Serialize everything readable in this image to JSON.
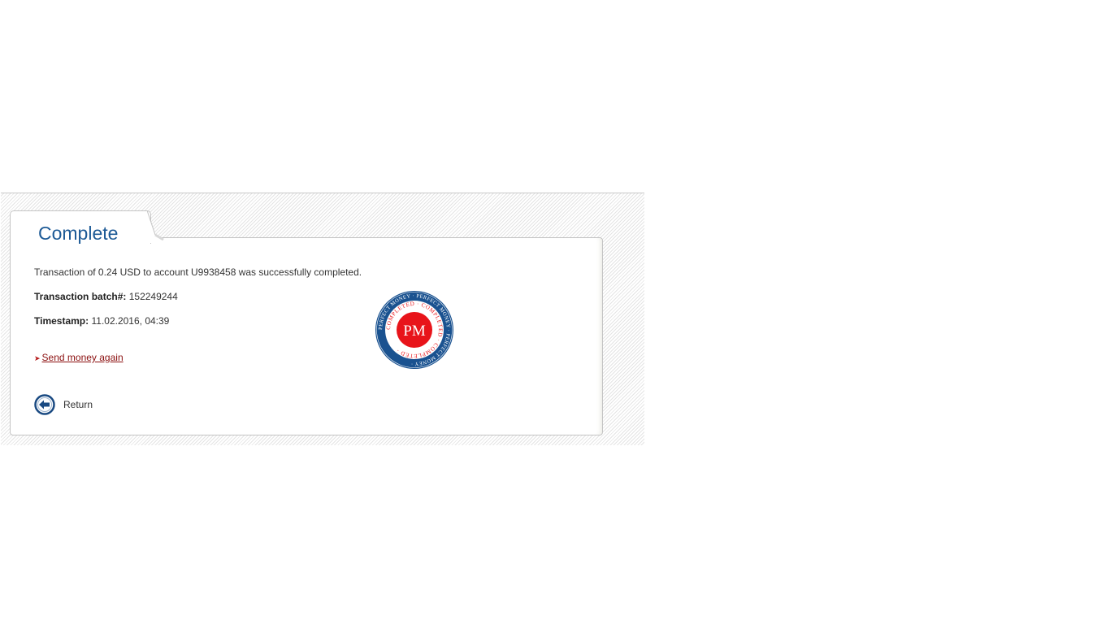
{
  "panel": {
    "title": "Complete"
  },
  "transaction": {
    "message": "Transaction of 0.24 USD to account U9938458 was successfully completed.",
    "batch_label": "Transaction batch#:",
    "batch_value": "152249244",
    "timestamp_label": "Timestamp:",
    "timestamp_value": "11.02.2016, 04:39"
  },
  "actions": {
    "send_again_label": "Send money again",
    "return_label": "Return"
  },
  "stamp": {
    "initials": "PM",
    "ring_text": "PERFECT MONEY",
    "inner_text": "COMPLETED"
  },
  "colors": {
    "title_blue": "#1d5a96",
    "link_red": "#8b0f0f",
    "stamp_red": "#e8141a",
    "stamp_blue": "#1a5290"
  },
  "icons": {
    "return": "arrow-left-circle-icon",
    "bullet": "small-arrow-icon"
  }
}
